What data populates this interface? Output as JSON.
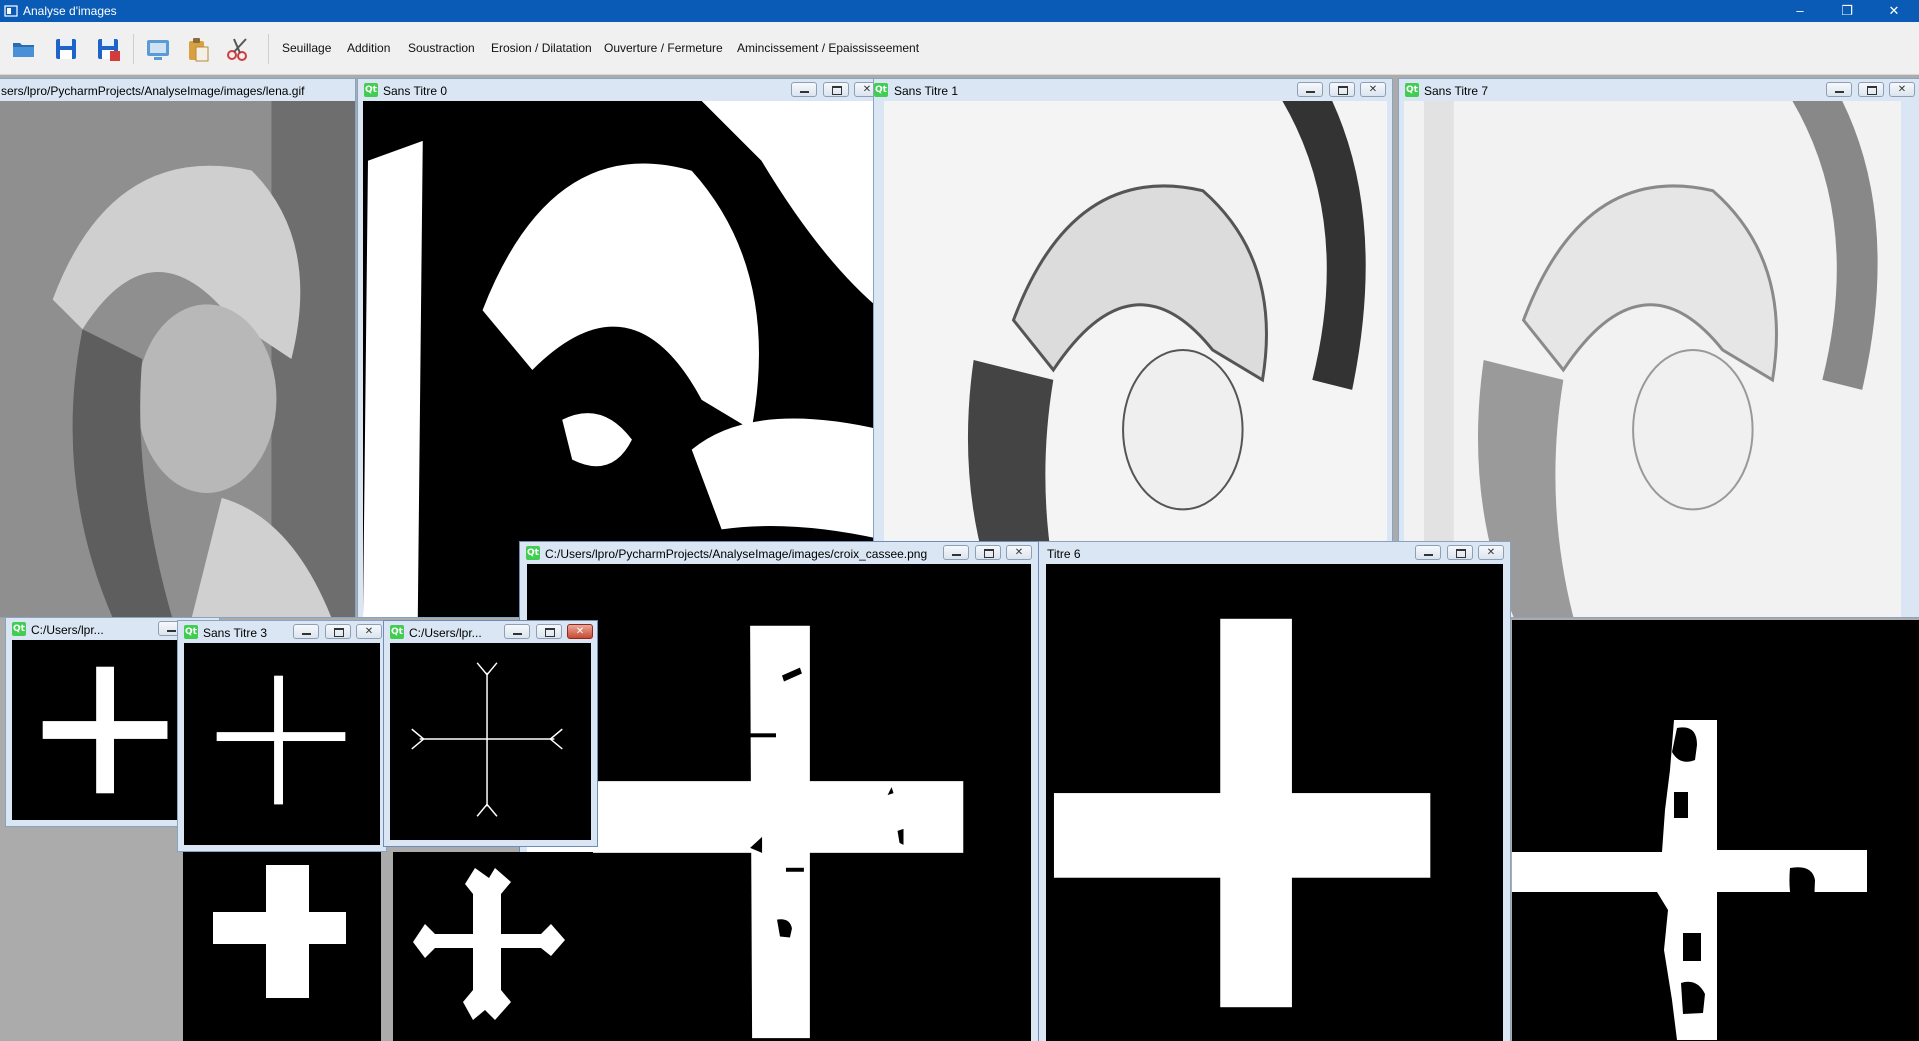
{
  "app": {
    "title": "Analyse d'images"
  },
  "window_controls": {
    "minimize": "–",
    "restore": "❐",
    "close": "✕"
  },
  "toolbar": {
    "icons": [
      "open-folder-icon",
      "save-icon",
      "save-as-icon",
      "screen-icon",
      "paste-icon",
      "cut-scissors-icon"
    ],
    "menus": [
      "Seuillage",
      "Addition",
      "Soustraction",
      "Erosion / Dilatation",
      "Ouverture / Fermeture",
      "Amincissement / Epaississeement"
    ]
  },
  "subwindows": {
    "lena": {
      "title": "sers/lpro/PycharmProjects/AnalyseImage/images/lena.gif"
    },
    "s0": {
      "title": "Sans Titre 0"
    },
    "s1": {
      "title": "Sans Titre 1"
    },
    "s7": {
      "title": "Sans Titre 7"
    },
    "croix": {
      "title": "C:/Users/lpro/PycharmProjects/AnalyseImage/images/croix_cassee.png"
    },
    "s6": {
      "title": "Titre 6"
    },
    "small1": {
      "title": "C:/Users/lpr..."
    },
    "s3": {
      "title": "Sans Titre 3"
    },
    "small3": {
      "title": "C:/Users/lpr..."
    }
  },
  "subwindow_controls": {
    "close": "✕"
  },
  "colors": {
    "title_bar": "#0a5bb5",
    "mdi_background": "#ababab",
    "subwindow_frame": "#dae6f3",
    "qt_green": "#41cd52",
    "close_active": "#c74a32"
  }
}
